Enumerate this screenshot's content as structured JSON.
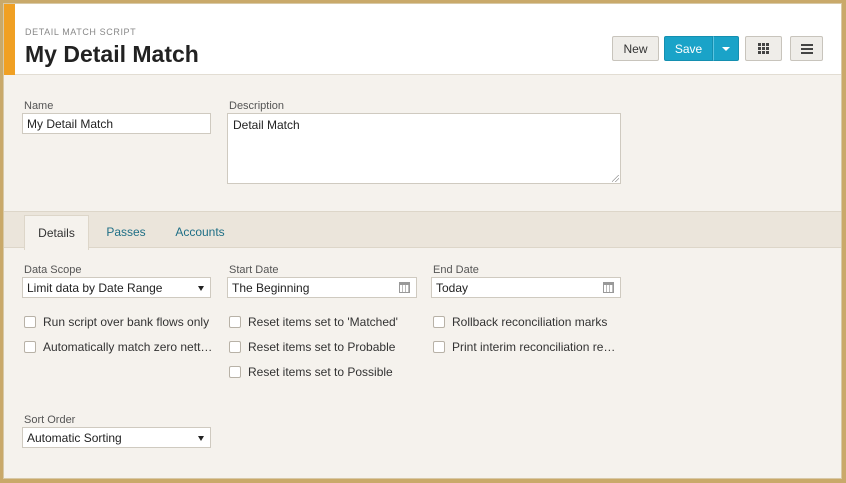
{
  "header": {
    "subtitle": "DETAIL MATCH SCRIPT",
    "title": "My Detail Match",
    "new_label": "New",
    "save_label": "Save"
  },
  "form": {
    "name": {
      "label": "Name",
      "value": "My Detail Match"
    },
    "description": {
      "label": "Description",
      "value": "Detail Match"
    }
  },
  "tabs": [
    {
      "label": "Details",
      "active": true
    },
    {
      "label": "Passes",
      "active": false
    },
    {
      "label": "Accounts",
      "active": false
    }
  ],
  "details": {
    "data_scope": {
      "label": "Data Scope",
      "value": "Limit data by Date Range"
    },
    "start_date": {
      "label": "Start Date",
      "value": "The Beginning"
    },
    "end_date": {
      "label": "End Date",
      "value": "Today"
    },
    "checkboxes": {
      "col1": [
        {
          "label": "Run script over bank flows only",
          "checked": false
        },
        {
          "label": "Automatically match zero nett…",
          "checked": false
        }
      ],
      "col2": [
        {
          "label": "Reset items set to 'Matched'",
          "checked": false
        },
        {
          "label": "Reset items set to Probable",
          "checked": false
        },
        {
          "label": "Reset items set to Possible",
          "checked": false
        }
      ],
      "col3": [
        {
          "label": "Rollback reconciliation marks",
          "checked": false
        },
        {
          "label": "Print interim reconciliation re…",
          "checked": false
        }
      ]
    },
    "sort_order": {
      "label": "Sort Order",
      "value": "Automatic Sorting"
    }
  }
}
